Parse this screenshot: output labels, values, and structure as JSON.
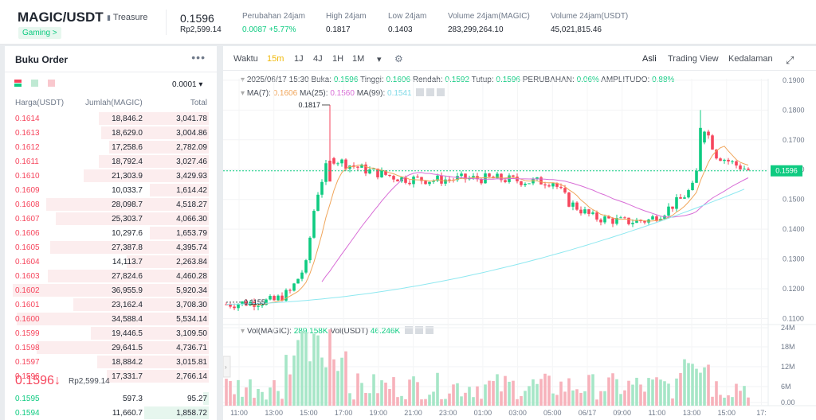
{
  "header": {
    "pair": "MAGIC/USDT",
    "treasure": "Treasure",
    "tag": "Gaming >",
    "price": "0.1596",
    "price_idr": "Rp2,599.14",
    "stats": [
      {
        "label": "Perubahan 24jam",
        "value": "0.0087 +5.77%"
      },
      {
        "label": "High 24jam",
        "value": "0.1817"
      },
      {
        "label": "Low 24jam",
        "value": "0.1403"
      },
      {
        "label": "Volume 24jam(MAGIC)",
        "value": "283,299,264.10"
      },
      {
        "label": "Volume 24jam(USDT)",
        "value": "45,021,815.46"
      }
    ]
  },
  "orderbook": {
    "title": "Buku Order",
    "more": "•••",
    "precision": "0.0001 ▾",
    "headers": {
      "price": "Harga(USDT)",
      "qty": "Jumlah(MAGIC)",
      "total": "Total"
    },
    "asks": [
      {
        "p": "0.1614",
        "q": "18,846.2",
        "t": "3,041.78",
        "d": 0.56
      },
      {
        "p": "0.1613",
        "q": "18,629.0",
        "t": "3,004.86",
        "d": 0.55
      },
      {
        "p": "0.1612",
        "q": "17,258.6",
        "t": "2,782.09",
        "d": 0.51
      },
      {
        "p": "0.1611",
        "q": "18,792.4",
        "t": "3,027.46",
        "d": 0.56
      },
      {
        "p": "0.1610",
        "q": "21,303.9",
        "t": "3,429.93",
        "d": 0.64
      },
      {
        "p": "0.1609",
        "q": "10,033.7",
        "t": "1,614.42",
        "d": 0.3
      },
      {
        "p": "0.1608",
        "q": "28,098.7",
        "t": "4,518.27",
        "d": 0.83
      },
      {
        "p": "0.1607",
        "q": "25,303.7",
        "t": "4,066.30",
        "d": 0.78
      },
      {
        "p": "0.1606",
        "q": "10,297.6",
        "t": "1,653.79",
        "d": 0.3
      },
      {
        "p": "0.1605",
        "q": "27,387.8",
        "t": "4,395.74",
        "d": 0.81
      },
      {
        "p": "0.1604",
        "q": "14,113.7",
        "t": "2,263.84",
        "d": 0.42
      },
      {
        "p": "0.1603",
        "q": "27,824.6",
        "t": "4,460.28",
        "d": 0.82
      },
      {
        "p": "0.1602",
        "q": "36,955.9",
        "t": "5,920.34",
        "d": 1.0
      },
      {
        "p": "0.1601",
        "q": "23,162.4",
        "t": "3,708.30",
        "d": 0.69
      },
      {
        "p": "0.1600",
        "q": "34,588.4",
        "t": "5,534.14",
        "d": 0.98
      },
      {
        "p": "0.1599",
        "q": "19,446.5",
        "t": "3,109.50",
        "d": 0.6
      },
      {
        "p": "0.1598",
        "q": "29,641.5",
        "t": "4,736.71",
        "d": 0.88
      },
      {
        "p": "0.1597",
        "q": "18,884.2",
        "t": "3,015.81",
        "d": 0.57
      },
      {
        "p": "0.1596",
        "q": "17,331.7",
        "t": "2,766.14",
        "d": 0.52
      }
    ],
    "mid": {
      "price": "0.1596↓",
      "idr": "Rp2,599.14"
    },
    "bids": [
      {
        "p": "0.1595",
        "q": "597.3",
        "t": "95.27",
        "d": 0.03
      },
      {
        "p": "0.1594",
        "q": "11,660.7",
        "t": "1,858.72",
        "d": 0.33
      }
    ]
  },
  "toolbar": {
    "items": [
      "Waktu",
      "15m",
      "1J",
      "4J",
      "1H",
      "1M",
      "▾"
    ],
    "active": "15m",
    "right": [
      "Asli",
      "Trading View",
      "Kedalaman"
    ]
  },
  "ohlc": {
    "date": "2025/06/17 15:30",
    "open_label": "Buka:",
    "open": "0.1596",
    "high_label": "Tinggi:",
    "high": "0.1606",
    "low_label": "Rendah:",
    "low": "0.1592",
    "close_label": "Tutup:",
    "close": "0.1596",
    "chg_label": "PERUBAHAN:",
    "chg": "0.06%",
    "amp_label": "AMPLITUDO:",
    "amp": "0.88%"
  },
  "ma": {
    "ma7_label": "MA(7):",
    "ma7": "0.1606",
    "ma25_label": "MA(25):",
    "ma25": "0.1560",
    "ma99_label": "MA(99):",
    "ma99": "0.1541"
  },
  "vol": {
    "magic_label": "Vol(MAGIC):",
    "magic": "289.158K",
    "usdt_label": "Vol(USDT)",
    "usdt": "46.246K"
  },
  "chart_data": {
    "type": "candlestick",
    "price_ticks": [
      "0.1900",
      "0.1800",
      "0.1700",
      "0.1600",
      "0.1500",
      "0.1400",
      "0.1300",
      "0.1200",
      "0.1100"
    ],
    "price_range": [
      0.108,
      0.1905
    ],
    "vol_ticks": [
      "24M",
      "18M",
      "12M",
      "6M",
      "0.00"
    ],
    "time_ticks": [
      "11:00",
      "13:00",
      "15:00",
      "17:00",
      "19:00",
      "21:00",
      "23:00",
      "01:00",
      "03:00",
      "05:00",
      "06/17",
      "09:00",
      "11:00",
      "13:00",
      "15:00",
      "17:"
    ],
    "current_price": "0.1596",
    "high_marker": "0.1817",
    "low_marker": "0.1155",
    "colors": {
      "up": "#0ecb81",
      "down": "#f6465d",
      "ma7": "#f0a55a",
      "ma25": "#d86dd6",
      "ma99": "#8ee8f0"
    }
  }
}
